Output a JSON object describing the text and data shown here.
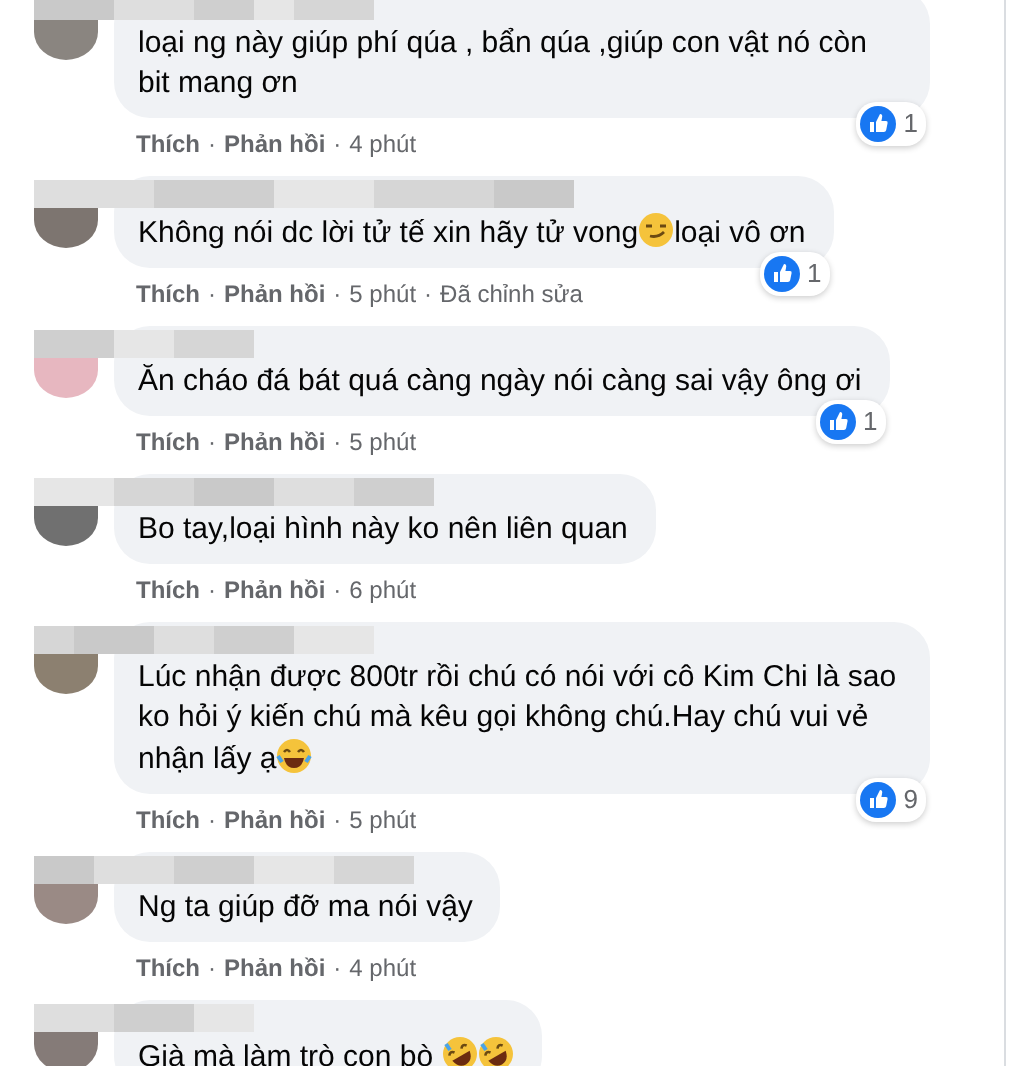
{
  "comments": [
    {
      "parts": [
        {
          "kind": "text",
          "text": "loại ng này giúp phí qúa , bẩn qúa ,giúp con vật nó còn bit mang ơn"
        }
      ],
      "reactions": "1",
      "meta": [
        {
          "kind": "action",
          "text": "Thích"
        },
        {
          "kind": "sep",
          "text": "·"
        },
        {
          "kind": "action",
          "text": "Phản hồi"
        },
        {
          "kind": "sep",
          "text": "·"
        },
        {
          "kind": "info",
          "text": "4 phút"
        }
      ]
    },
    {
      "parts": [
        {
          "kind": "text",
          "text": "Không nói dc lời tử tế xin hãy tử vong"
        },
        {
          "kind": "emoji-smirk"
        },
        {
          "kind": "text",
          "text": "loại vô ơn"
        }
      ],
      "reactions": "1",
      "meta": [
        {
          "kind": "action",
          "text": "Thích"
        },
        {
          "kind": "sep",
          "text": "·"
        },
        {
          "kind": "action",
          "text": "Phản hồi"
        },
        {
          "kind": "sep",
          "text": "·"
        },
        {
          "kind": "info",
          "text": "5 phút"
        },
        {
          "kind": "sep",
          "text": "·"
        },
        {
          "kind": "info",
          "text": "Đã chỉnh sửa"
        }
      ]
    },
    {
      "parts": [
        {
          "kind": "text",
          "text": "Ăn cháo đá bát quá càng ngày nói càng sai vậy ông ơi"
        }
      ],
      "reactions": "1",
      "meta": [
        {
          "kind": "action",
          "text": "Thích"
        },
        {
          "kind": "sep",
          "text": "·"
        },
        {
          "kind": "action",
          "text": "Phản hồi"
        },
        {
          "kind": "sep",
          "text": "·"
        },
        {
          "kind": "info",
          "text": "5 phút"
        }
      ]
    },
    {
      "parts": [
        {
          "kind": "text",
          "text": "Bo tay,loại hình này ko nên liên quan"
        }
      ],
      "meta": [
        {
          "kind": "action",
          "text": "Thích"
        },
        {
          "kind": "sep",
          "text": "·"
        },
        {
          "kind": "action",
          "text": "Phản hồi"
        },
        {
          "kind": "sep",
          "text": "·"
        },
        {
          "kind": "info",
          "text": "6 phút"
        }
      ]
    },
    {
      "parts": [
        {
          "kind": "text",
          "text": "Lúc nhận được 800tr rồi chú có nói với cô Kim Chi là sao ko hỏi ý kiến chú mà kêu gọi không chú.Hay chú vui vẻ nhận lấy ạ"
        },
        {
          "kind": "emoji-joy"
        }
      ],
      "reactions": "9",
      "meta": [
        {
          "kind": "action",
          "text": "Thích"
        },
        {
          "kind": "sep",
          "text": "·"
        },
        {
          "kind": "action",
          "text": "Phản hồi"
        },
        {
          "kind": "sep",
          "text": "·"
        },
        {
          "kind": "info",
          "text": "5 phút"
        }
      ]
    },
    {
      "parts": [
        {
          "kind": "text",
          "text": "Ng ta giúp đỡ ma nói vậy"
        }
      ],
      "meta": [
        {
          "kind": "action",
          "text": "Thích"
        },
        {
          "kind": "sep",
          "text": "·"
        },
        {
          "kind": "action",
          "text": "Phản hồi"
        },
        {
          "kind": "sep",
          "text": "·"
        },
        {
          "kind": "info",
          "text": "4 phút"
        }
      ]
    },
    {
      "parts": [
        {
          "kind": "text",
          "text": "Già mà làm trò con bò "
        },
        {
          "kind": "emoji-rofl"
        },
        {
          "kind": "emoji-rofl"
        }
      ]
    }
  ]
}
